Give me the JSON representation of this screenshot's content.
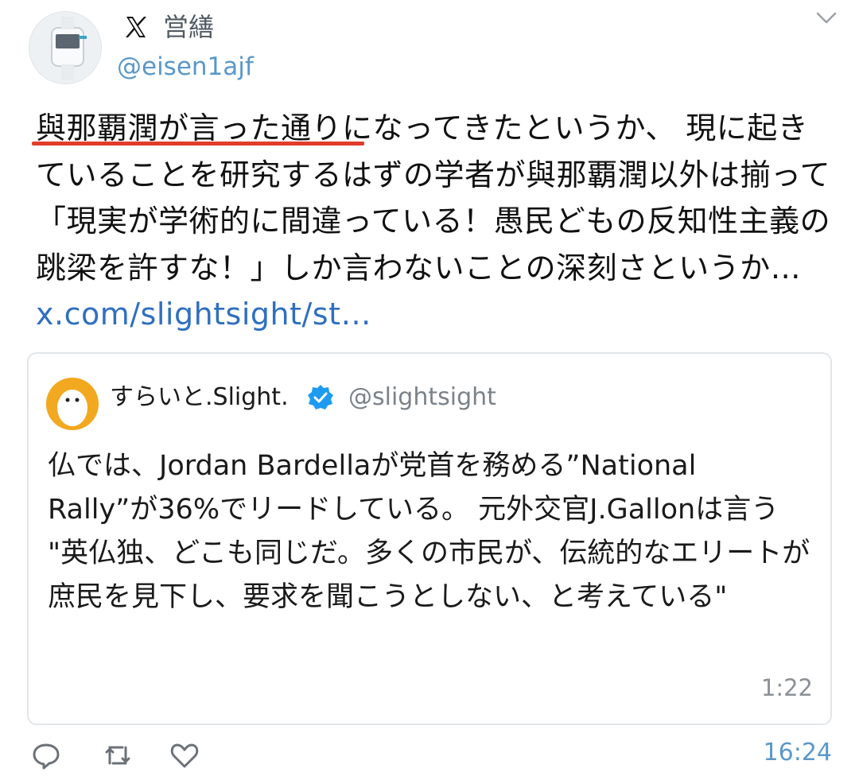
{
  "author": {
    "name": "営繕",
    "handle": "@eisen1ajf"
  },
  "tweet": {
    "text": "與那覇潤が言った通りになってきたというか、 現に起きていることを研究するはずの学者が與那覇潤以外は揃って「現実が学術的に間違っている！愚民どもの反知性主義の跳梁を許すな！」しか言わないことの深刻さというか…",
    "link": "x.com/slightsight/st…",
    "time": "16:24"
  },
  "quote": {
    "name": "すらいと.Slight.",
    "handle": "@slightsight",
    "text": "仏では、Jordan Bardellaが党首を務める”National Rally”が36%でリードしている。 元外交官J.Gallonは言う \"英仏独、どこも同じだ。多くの市民が、伝統的なエリートが庶民を見下し、要求を聞こうとしない、と考えている\"",
    "time": "1:22"
  },
  "icons": {
    "platform": "x-logo-icon",
    "menu": "chevron-down-icon",
    "verified": "verified-badge-icon",
    "reply": "reply-icon",
    "retweet": "retweet-icon",
    "like": "heart-icon"
  },
  "colors": {
    "link": "#2f6fc1",
    "handle": "#5a98c9",
    "highlight_underline": "#e23c2a",
    "verified": "#1d9bf0"
  }
}
